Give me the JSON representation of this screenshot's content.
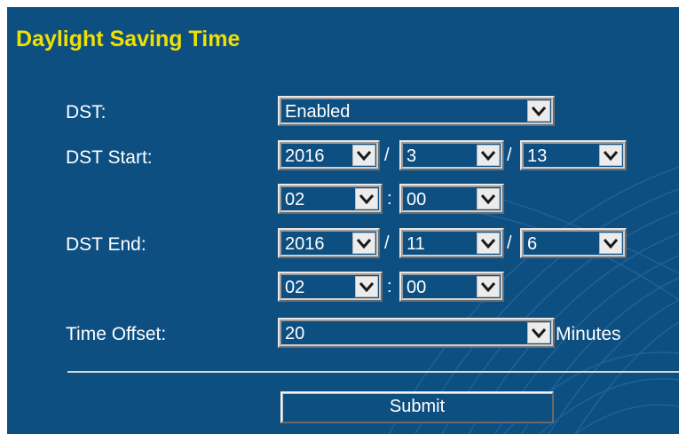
{
  "title": "Daylight Saving Time",
  "dst": {
    "label": "DST:",
    "value": "Enabled"
  },
  "start": {
    "label": "DST Start:",
    "year": "2016",
    "month": "3",
    "day": "13",
    "hour": "02",
    "minute": "00"
  },
  "end": {
    "label": "DST End:",
    "year": "2016",
    "month": "11",
    "day": "6",
    "hour": "02",
    "minute": "00"
  },
  "offset": {
    "label": "Time Offset:",
    "value": "20",
    "unit": "Minutes"
  },
  "separators": {
    "date": "/",
    "time": ":"
  },
  "submit_label": "Submit",
  "colors": {
    "background": "#0e4f82",
    "title": "#f0e000",
    "text": "#ffffff"
  },
  "icons": {
    "dropdown": "chevron-down-icon"
  }
}
